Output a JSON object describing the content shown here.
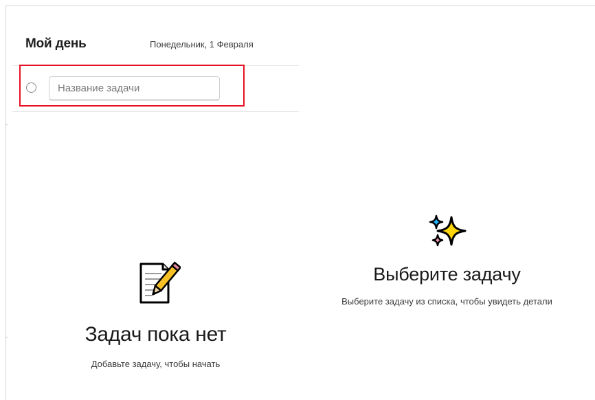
{
  "header": {
    "title": "Мой день",
    "date": "Понедельник, 1 Февраля"
  },
  "new_task": {
    "placeholder": "Название задачи",
    "value": ""
  },
  "task_list_empty": {
    "icon": "notepad-icon",
    "title": "Задач пока нет",
    "subtitle": "Добавьте задачу, чтобы начать"
  },
  "detail_empty": {
    "icon": "sparkles-icon",
    "title": "Выберите задачу",
    "subtitle": "Выберите задачу из списка, чтобы увидеть детали"
  },
  "colors": {
    "highlight": "#e81123",
    "sparkle_yellow": "#ffd60a",
    "sparkle_blue": "#1fb6ff",
    "sparkle_pink": "#f49ac1"
  }
}
